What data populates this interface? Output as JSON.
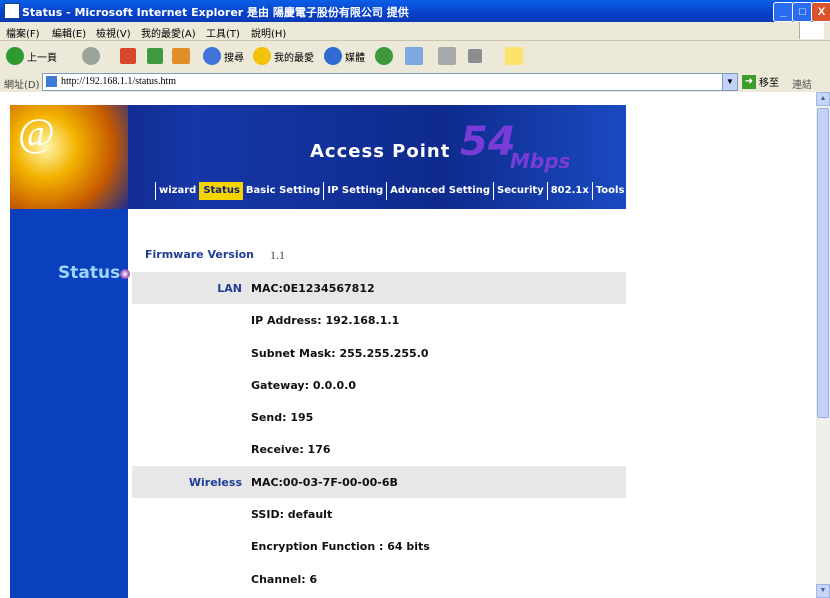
{
  "window": {
    "title": "Status - Microsoft Internet Explorer 是由 陽慶電子股份有限公司 提供",
    "min_label": "_",
    "max_label": "□",
    "close_label": "X"
  },
  "menu": [
    "檔案(F)",
    "編輯(E)",
    "檢視(V)",
    "我的最愛(A)",
    "工具(T)",
    "說明(H)"
  ],
  "toolbar": {
    "back_label": "上一頁",
    "search_label": "搜尋",
    "favorites_label": "我的最愛",
    "media_label": "媒體"
  },
  "address": {
    "label": "網址(D)",
    "url": "http://192.168.1.1/status.htm",
    "go_label": "移至",
    "links_label": "連結"
  },
  "banner": {
    "brand": "Access Point",
    "speed": "54",
    "speed_unit": "Mbps",
    "nav": [
      "wizard",
      "Status",
      "Basic  Setting",
      "IP Setting",
      "Advanced Setting",
      "Security",
      "802.1x",
      "Tools"
    ],
    "active_nav": "Status"
  },
  "sidebar": {
    "title": "Status"
  },
  "status": {
    "firmware_label": "Firmware Version",
    "firmware_value": "1.1",
    "rows": [
      {
        "key": "LAN",
        "value": "MAC:0E1234567812",
        "shade": true
      },
      {
        "key": "",
        "value": "IP Address: 192.168.1.1",
        "shade": false
      },
      {
        "key": "",
        "value": "Subnet Mask: 255.255.255.0",
        "shade": false
      },
      {
        "key": "",
        "value": "Gateway: 0.0.0.0",
        "shade": false
      },
      {
        "key": "",
        "value": "Send: 195",
        "shade": false
      },
      {
        "key": "",
        "value": "Receive: 176",
        "shade": false
      },
      {
        "key": "Wireless",
        "value": "MAC:00-03-7F-00-00-6B",
        "shade": true
      },
      {
        "key": "",
        "value": "SSID: default",
        "shade": false
      },
      {
        "key": "",
        "value": "Encryption Function : 64 bits",
        "shade": false
      },
      {
        "key": "",
        "value": "Channel: 6",
        "shade": false
      }
    ]
  }
}
